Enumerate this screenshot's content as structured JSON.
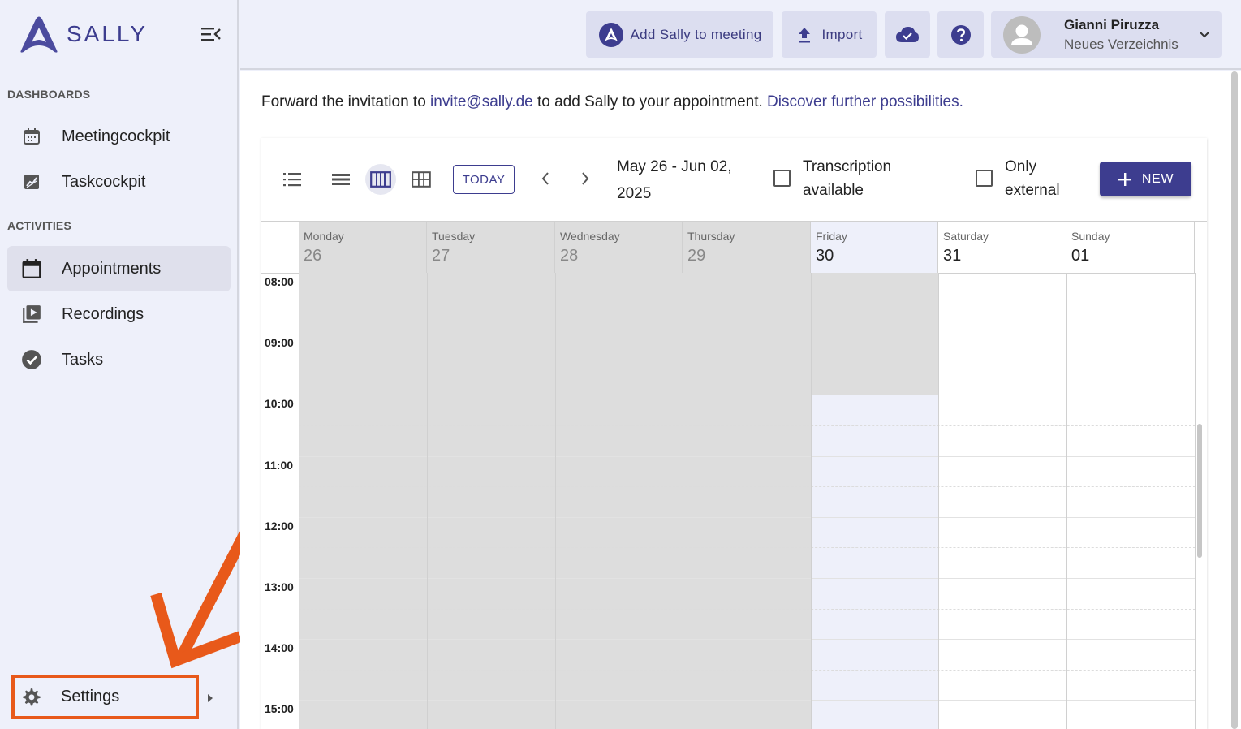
{
  "brand": {
    "name": "SALLY",
    "color": "#3d3d8f"
  },
  "sidebar": {
    "sections": [
      {
        "label": "DASHBOARDS"
      },
      {
        "label": "ACTIVITIES"
      }
    ],
    "items": [
      {
        "label": "Meetingcockpit",
        "icon": "calendar-grid-icon"
      },
      {
        "label": "Taskcockpit",
        "icon": "chart-icon"
      },
      {
        "label": "Appointments",
        "icon": "calendar-icon",
        "active": true
      },
      {
        "label": "Recordings",
        "icon": "video-library-icon"
      },
      {
        "label": "Tasks",
        "icon": "check-circle-icon"
      }
    ],
    "settings": {
      "label": "Settings",
      "icon": "gear-icon",
      "highlight_color": "#e8591a"
    }
  },
  "topbar": {
    "add_sally_label": "Add Sally to meeting",
    "import_label": "Import",
    "user": {
      "name": "Gianni Piruzza",
      "directory": "Neues Verzeichnis"
    }
  },
  "main": {
    "invite_prefix": "Forward the invitation to ",
    "invite_email": "invite@sally.de",
    "invite_middle": " to add Sally to your appointment. ",
    "invite_link": "Discover further possibilities."
  },
  "calendar": {
    "today_label": "TODAY",
    "range_line1": "May 26 - Jun 02,",
    "range_line2": "2025",
    "filter_transcription_line1": "Transcription",
    "filter_transcription_line2": "available",
    "filter_transcription_checked": false,
    "filter_external_line1": "Only",
    "filter_external_line2": "external",
    "filter_external_checked": false,
    "new_label": "NEW",
    "view_selected": "week",
    "days": [
      {
        "name": "Monday",
        "num": "26"
      },
      {
        "name": "Tuesday",
        "num": "27"
      },
      {
        "name": "Wednesday",
        "num": "28"
      },
      {
        "name": "Thursday",
        "num": "29"
      },
      {
        "name": "Friday",
        "num": "30"
      },
      {
        "name": "Saturday",
        "num": "31"
      },
      {
        "name": "Sunday",
        "num": "01"
      }
    ],
    "times": [
      "08:00",
      "09:00",
      "10:00",
      "11:00",
      "12:00",
      "13:00",
      "14:00",
      "15:00"
    ],
    "past_color": "#dddddd",
    "today_color": "#eef0fa"
  }
}
